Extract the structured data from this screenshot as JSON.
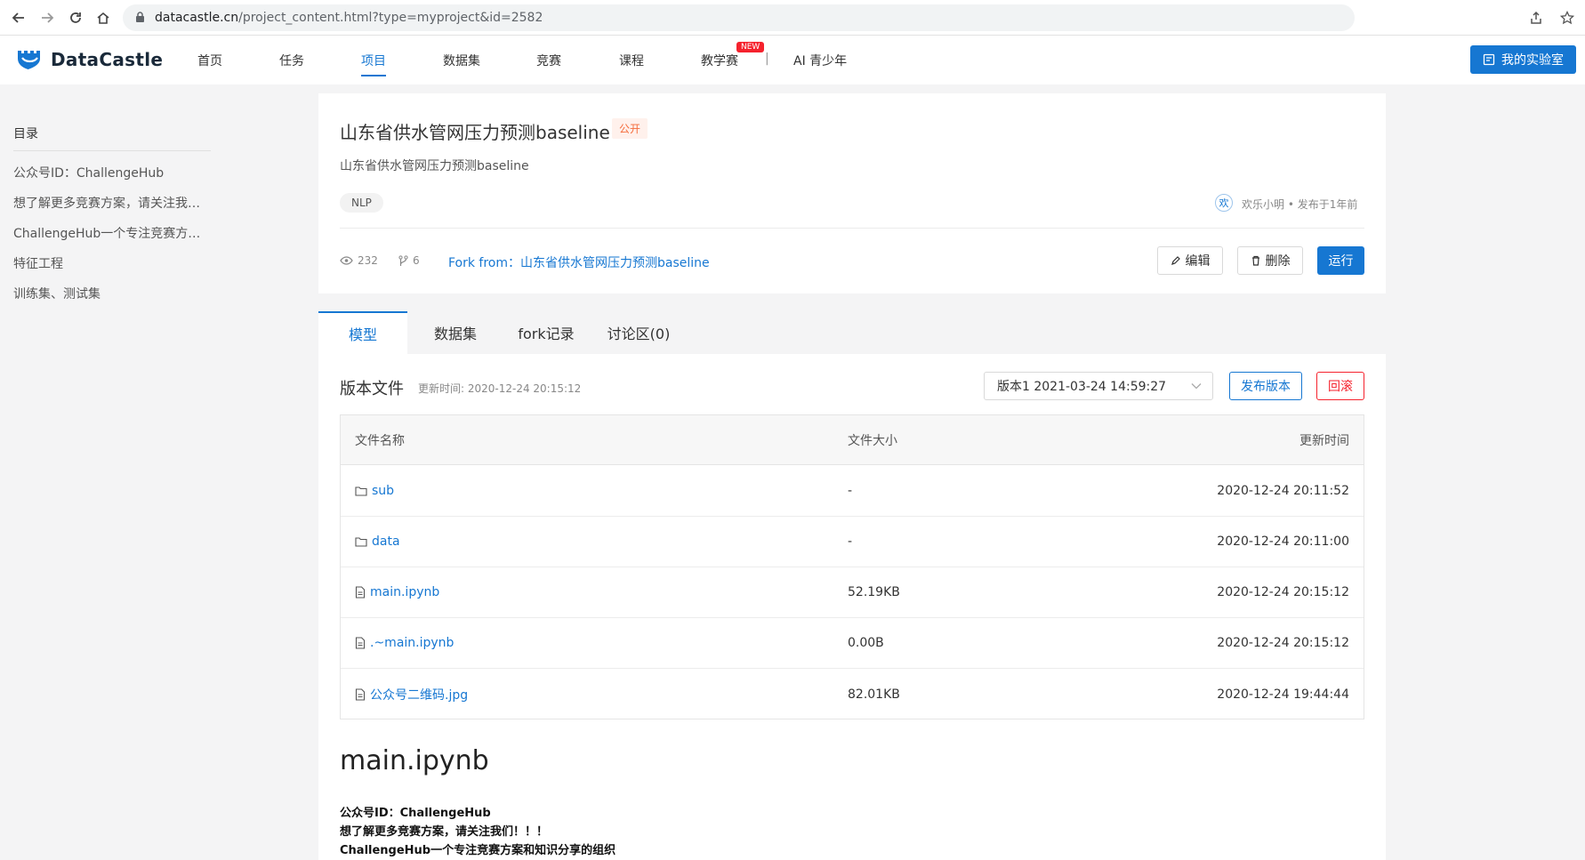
{
  "browser": {
    "url_host": "datacastle.cn",
    "url_path": "/project_content.html?type=myproject&id=2582"
  },
  "header": {
    "logo_text": "DataCastle",
    "nav": [
      "首页",
      "任务",
      "项目",
      "数据集",
      "竞赛",
      "课程",
      "教学赛",
      "AI 青少年"
    ],
    "active_nav": "项目",
    "new_badge": "NEW",
    "separator": "|",
    "lab_button": "我的实验室"
  },
  "toc": {
    "title": "目录",
    "items": [
      "公众号ID：ChallengeHub",
      "想了解更多竞赛方案，请关注我们！！！",
      "ChallengeHub一个专注竞赛方案和知识分享的组织",
      "特征工程",
      "训练集、测试集"
    ]
  },
  "project": {
    "title": "山东省供水管网压力预测baseline",
    "visibility": "公开",
    "description": "山东省供水管网压力预测baseline",
    "tag": "NLP",
    "author_avatar": "欢",
    "author_info": "欢乐小明 • 发布于1年前",
    "views": "232",
    "forks": "6",
    "fork_from": "Fork from：山东省供水管网压力预测baseline",
    "edit_button": "编辑",
    "delete_button": "删除",
    "run_button": "运行"
  },
  "tabs": [
    "模型",
    "数据集",
    "fork记录",
    "讨论区(0)"
  ],
  "version": {
    "title": "版本文件",
    "updated": "更新时间:  2020-12-24 20:15:12",
    "selected": "版本1 2021-03-24 14:59:27",
    "publish_button": "发布版本",
    "rollback_button": "回滚"
  },
  "files": {
    "headers": [
      "文件名称",
      "文件大小",
      "更新时间"
    ],
    "rows": [
      {
        "icon": "folder-icon",
        "name": "sub",
        "size": "-",
        "time": "2020-12-24 20:11:52"
      },
      {
        "icon": "folder-icon",
        "name": "data",
        "size": "-",
        "time": "2020-12-24 20:11:00"
      },
      {
        "icon": "file-icon",
        "name": "main.ipynb",
        "size": "52.19KB",
        "time": "2020-12-24 20:15:12"
      },
      {
        "icon": "file-icon",
        "name": ".~main.ipynb",
        "size": "0.00B",
        "time": "2020-12-24 20:15:12"
      },
      {
        "icon": "file-icon",
        "name": "公众号二维码.jpg",
        "size": "82.01KB",
        "time": "2020-12-24 19:44:44"
      }
    ]
  },
  "notebook": {
    "title": "main.ipynb",
    "lines": [
      "公众号ID：ChallengeHub",
      "想了解更多竞赛方案，请关注我们！！！",
      "ChallengeHub一个专注竞赛方案和知识分享的组织"
    ]
  },
  "colors": {
    "accent": "#1677d2",
    "danger": "#f5222d",
    "public_tag": "#f56c3c"
  }
}
